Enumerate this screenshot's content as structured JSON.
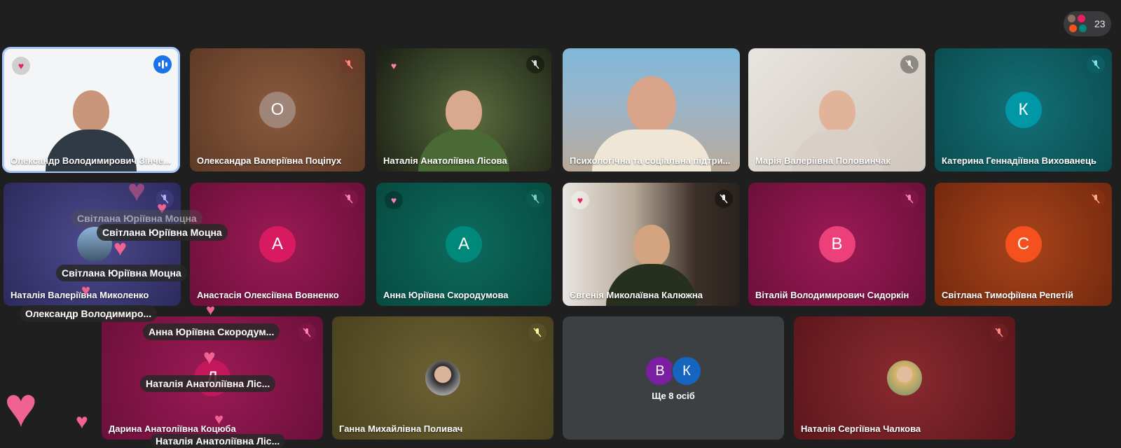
{
  "participants_count": "23",
  "tiles": [
    {
      "name": "Олександр Володимирович Зінче...",
      "letter": ""
    },
    {
      "name": "Олександра Валеріївна Поціпух",
      "letter": "О"
    },
    {
      "name": "Наталія Анатоліївна Лісова",
      "letter": ""
    },
    {
      "name": "Психологічна та соціальна підтри...",
      "letter": ""
    },
    {
      "name": "Марія Валеріївна Половинчак",
      "letter": ""
    },
    {
      "name": "Катерина Геннадіївна Вихованець",
      "letter": "К"
    },
    {
      "name": "Наталія Валеріївна Миколенко",
      "letter": ""
    },
    {
      "name": "Анастасія Олексіївна Вовненко",
      "letter": "А"
    },
    {
      "name": "Анна Юріївна Скородумова",
      "letter": "А"
    },
    {
      "name": "Євгенія Миколаївна Калюжна",
      "letter": ""
    },
    {
      "name": "Віталій Володимирович Сидоркін",
      "letter": "В"
    },
    {
      "name": "Світлана Тимофіївна Репетій",
      "letter": "С"
    },
    {
      "name": "Дарина Анатоліївна Коцюба",
      "letter": "Д"
    },
    {
      "name": "Ганна Михайлівна Поливач",
      "letter": ""
    },
    {
      "name": "Наталія Сергіївна Чалкова",
      "letter": ""
    }
  ],
  "more_tile": {
    "avatars": [
      "В",
      "К"
    ],
    "text": "Ще 8 осіб"
  },
  "reactions": [
    "Світлана Юріївна Моцна",
    "Світлана Юріївна Моцна",
    "Світлана Юріївна Моцна",
    "Олександр Володимиро...",
    "Анна Юріївна Скородум...",
    "Наталія Анатоліївна Ліс...",
    "Наталія Анатоліївна Ліс..."
  ],
  "icons": {
    "heart": "heart-icon",
    "mic_off": "mic-off-icon",
    "speaking": "audio-level-icon"
  },
  "colors": {
    "background": "#1f1f1f",
    "active_outline": "#a8c7fa",
    "speaking_badge": "#1a73e8"
  }
}
